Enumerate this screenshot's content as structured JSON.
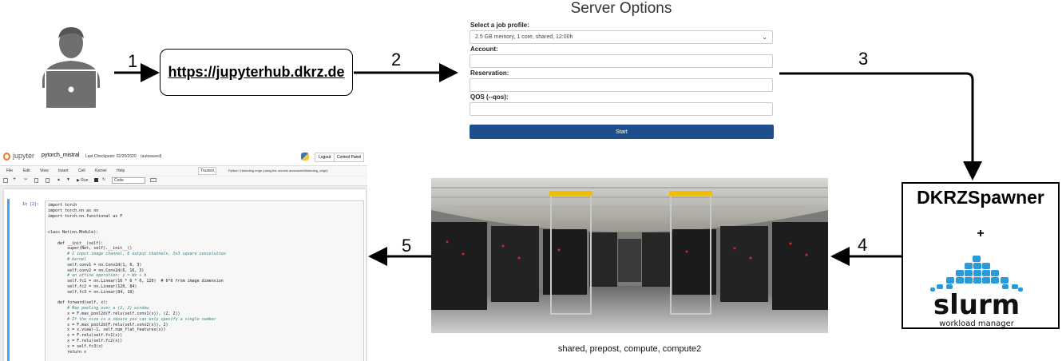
{
  "steps": [
    "1",
    "2",
    "3",
    "4",
    "5"
  ],
  "url_box": {
    "text": "https://jupyterhub.dkrz.de"
  },
  "server_options": {
    "title": "Server Options",
    "profile_label": "Select a job profile:",
    "profile_value": "2.5 GB memory, 1 core, shared, 12:00h",
    "account_label": "Account:",
    "reservation_label": "Reservation:",
    "qos_label": "QOS (--qos):",
    "start_label": "Start"
  },
  "spawner": {
    "title": "DKRZSpawner",
    "plus": "+",
    "slurm_text": "slurm",
    "slurm_subtitle": "workload manager"
  },
  "photo_caption": "shared, prepost, compute, compute2",
  "jupyter": {
    "logo": "jupyter",
    "notebook_name": "pytorch_mistral",
    "checkpoint": "Last Checkpoint: 02/20/2020",
    "autosaved": "(autosaved)",
    "logout": "Logout",
    "control_panel": "Control Panel",
    "menu": [
      "File",
      "Edit",
      "View",
      "Insert",
      "Cell",
      "Kernel",
      "Help"
    ],
    "trusted": "Trusted",
    "kernel": "Python 3 bleeding edge (using the module anaconda3/bleeding_edge)",
    "run": "Run",
    "cell_type": "Code",
    "prompt": "In [2]:",
    "code_lines": [
      {
        "t": "import torch",
        "c": "n"
      },
      {
        "t": "import torch.nn as nn",
        "c": "n"
      },
      {
        "t": "import torch.nn.functional as F",
        "c": "n"
      },
      {
        "t": "",
        "c": "n"
      },
      {
        "t": "",
        "c": "n"
      },
      {
        "t": "class Net(nn.Module):",
        "c": "n"
      },
      {
        "t": "",
        "c": "n"
      },
      {
        "t": "    def __init__(self):",
        "c": "n"
      },
      {
        "t": "        super(Net, self).__init__()",
        "c": "n"
      },
      {
        "t": "        # 1 input image channel, 6 output channels, 3x3 square convolution",
        "c": "c"
      },
      {
        "t": "        # kernel",
        "c": "c"
      },
      {
        "t": "        self.conv1 = nn.Conv2d(1, 6, 3)",
        "c": "n"
      },
      {
        "t": "        self.conv2 = nn.Conv2d(6, 16, 3)",
        "c": "n"
      },
      {
        "t": "        # an affine operation: y = Wx + b",
        "c": "c"
      },
      {
        "t": "        self.fc1 = nn.Linear(16 * 6 * 6, 120)  # 6*6 from image dimension",
        "c": "n"
      },
      {
        "t": "        self.fc2 = nn.Linear(120, 84)",
        "c": "n"
      },
      {
        "t": "        self.fc3 = nn.Linear(84, 10)",
        "c": "n"
      },
      {
        "t": "",
        "c": "n"
      },
      {
        "t": "    def forward(self, x):",
        "c": "n"
      },
      {
        "t": "        # Max pooling over a (2, 2) window",
        "c": "c"
      },
      {
        "t": "        x = F.max_pool2d(F.relu(self.conv1(x)), (2, 2))",
        "c": "n"
      },
      {
        "t": "        # If the size is a square you can only specify a single number",
        "c": "c"
      },
      {
        "t": "        x = F.max_pool2d(F.relu(self.conv2(x)), 2)",
        "c": "n"
      },
      {
        "t": "        x = x.view(-1, self.num_flat_features(x))",
        "c": "n"
      },
      {
        "t": "        x = F.relu(self.fc1(x))",
        "c": "n"
      },
      {
        "t": "        x = F.relu(self.fc2(x))",
        "c": "n"
      },
      {
        "t": "        x = self.fc3(x)",
        "c": "n"
      },
      {
        "t": "        return x",
        "c": "n"
      }
    ]
  },
  "colors": {
    "start_button": "#1f4e8c",
    "slurm_blue": "#2a9bd8",
    "jupyter_orange": "#f37726"
  },
  "icons": [
    "user-laptop-icon",
    "python-icon",
    "slurm-logo-icon"
  ]
}
